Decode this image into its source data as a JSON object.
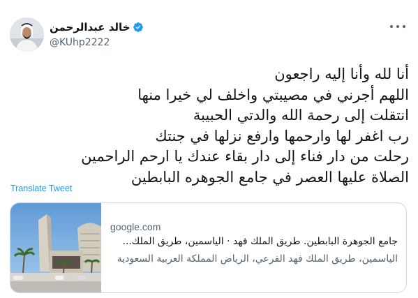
{
  "author": {
    "display_name": "خالد عبدالرحمن",
    "handle": "@KUhp2222",
    "verified": true,
    "avatar_icon": "user-avatar"
  },
  "more_icon": "more-options-icon",
  "tweet_lines": [
    "أنا لله وأنا إليه راجعون",
    "اللهم أجرني في مصيبتي واخلف لي خيرا منها",
    "انتقلت إلى رحمة الله والدتي الحبيبة",
    "رب اغفر لها وارحمها وارفع نزلها في جنتك",
    "رحلت من دار فناء إلى دار بقاء عندك يا ارحم الراحمين",
    "الصلاة عليها العصر في جامع الجوهره البابطين"
  ],
  "translate_label": "Translate Tweet",
  "link_card": {
    "domain": "google.com",
    "title": "جامع الجوهرة البابطين. طريق الملك فهد · الياسمين، طريق الملك...",
    "description": "الياسمين، طريق الملك فهد الفرعي، الرياض المملكة العربية السعودية"
  },
  "colors": {
    "link_blue": "#1d9bf0",
    "verified_blue": "#1d9bf0",
    "secondary_text": "#536471",
    "border": "#cfd9de"
  }
}
